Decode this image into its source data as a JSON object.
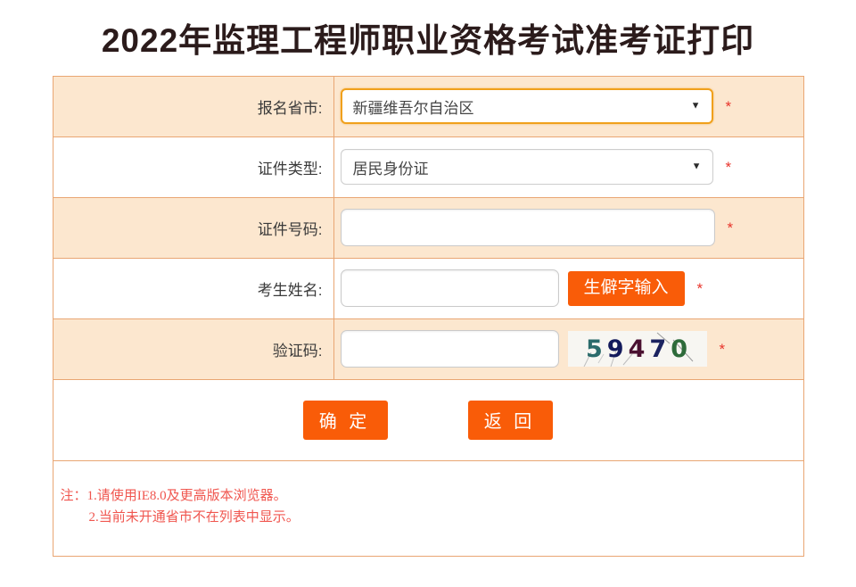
{
  "page": {
    "title": "2022年监理工程师职业资格考试准考证打印"
  },
  "form": {
    "required_marker": "*",
    "rows": [
      {
        "label": "报名省市:",
        "control": "select",
        "value": "新疆维吾尔自治区",
        "focused": true
      },
      {
        "label": "证件类型:",
        "control": "select",
        "value": "居民身份证",
        "focused": false
      },
      {
        "label": "证件号码:",
        "control": "input",
        "value": "",
        "placeholder": ""
      },
      {
        "label": "考生姓名:",
        "control": "input-with-button",
        "value": "",
        "placeholder": "",
        "button_label": "生僻字输入"
      },
      {
        "label": "验证码:",
        "control": "input-with-captcha",
        "value": "",
        "placeholder": "",
        "captcha_text": "59470"
      }
    ],
    "captcha": {
      "text": "59470",
      "digits": [
        {
          "char": "5",
          "color": "#2b6b6b"
        },
        {
          "char": "9",
          "color": "#131a5c"
        },
        {
          "char": "4",
          "color": "#4a1030"
        },
        {
          "char": "7",
          "color": "#1b2360"
        },
        {
          "char": "0",
          "color": "#2e6b3a"
        }
      ],
      "background": "#f7f6f2"
    },
    "actions": {
      "confirm_label": "确 定",
      "back_label": "返 回"
    }
  },
  "notes": {
    "items": [
      "注：1.请使用IE8.0及更高版本浏览器。",
      "2.当前未开通省市不在列表中显示。"
    ]
  },
  "colors": {
    "accent_orange": "#f95c08",
    "focus_orange": "#f0a01c",
    "table_border": "#e9a673",
    "row_shaded": "#fce7cf",
    "note_red": "#f0564f",
    "star_red": "#e8342b"
  }
}
